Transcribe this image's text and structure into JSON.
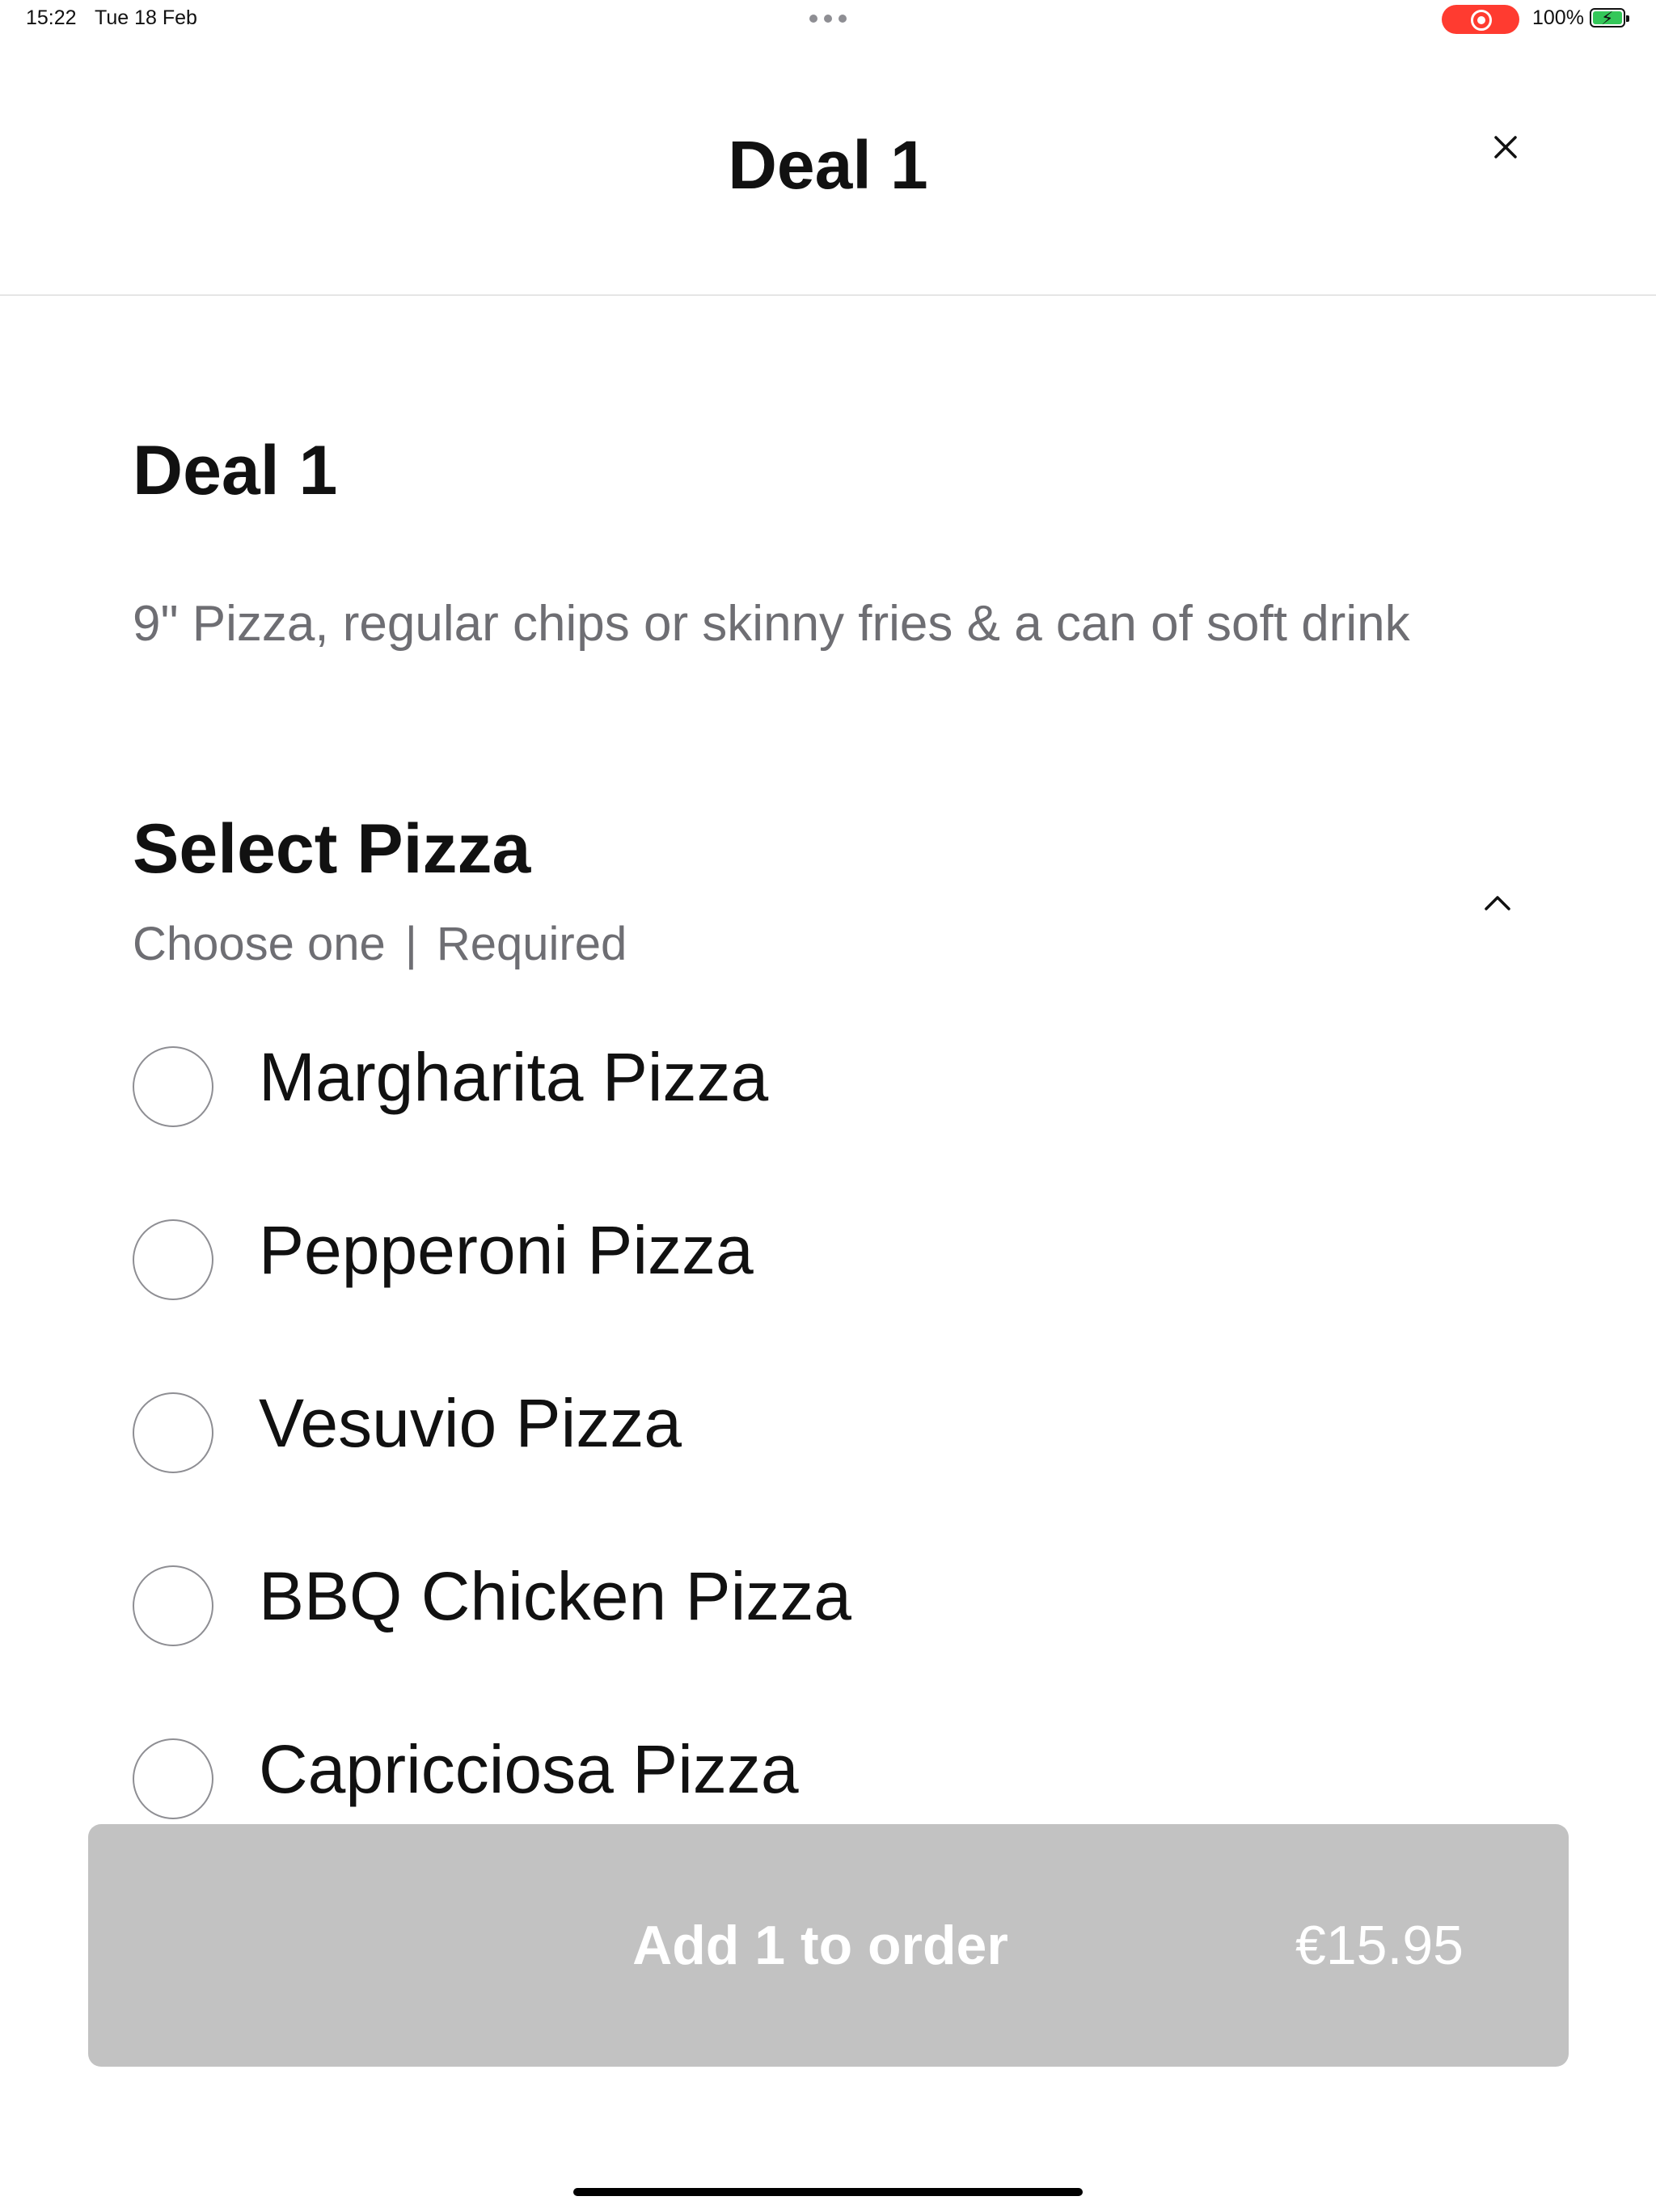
{
  "status_bar": {
    "time": "15:22",
    "date": "Tue 18 Feb",
    "battery_percent": "100%",
    "battery_level": 1.0,
    "recording_color": "#ff3b30",
    "battery_color": "#34c759"
  },
  "header": {
    "title": "Deal 1",
    "close_icon": "close-icon"
  },
  "deal": {
    "title": "Deal 1",
    "description": "9\" Pizza, regular chips or skinny fries & a can of soft drink"
  },
  "section": {
    "title": "Select Pizza",
    "choose": "Choose one",
    "separator": "|",
    "required": "Required",
    "toggle_icon": "chevron-up-icon"
  },
  "options": [
    {
      "label": "Margharita Pizza",
      "selected": false
    },
    {
      "label": "Pepperoni Pizza",
      "selected": false
    },
    {
      "label": "Vesuvio Pizza",
      "selected": false
    },
    {
      "label": "BBQ Chicken Pizza",
      "selected": false
    },
    {
      "label": "Capricciosa Pizza",
      "selected": false
    }
  ],
  "cta": {
    "label": "Add 1 to order",
    "price": "€15.95",
    "disabled_color": "#c2c2c2"
  }
}
